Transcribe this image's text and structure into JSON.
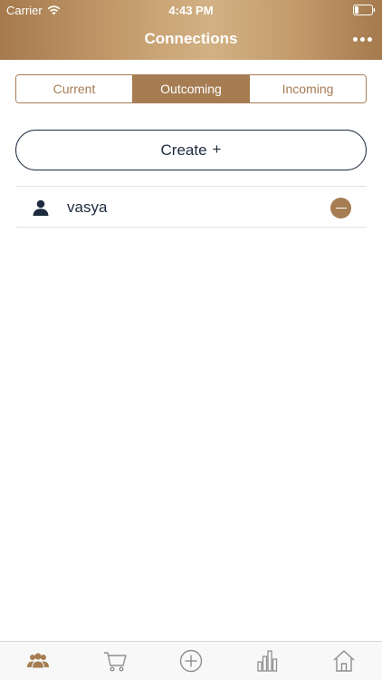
{
  "status_bar": {
    "carrier": "Carrier",
    "time": "4:43 PM"
  },
  "nav": {
    "title": "Connections",
    "more_icon": "ellipsis-icon"
  },
  "segments": [
    {
      "label": "Current",
      "active": false
    },
    {
      "label": "Outcoming",
      "active": true
    },
    {
      "label": "Incoming",
      "active": false
    }
  ],
  "create_button": {
    "label": "Create",
    "icon": "+"
  },
  "connections": [
    {
      "name": "vasya",
      "icon": "person-icon",
      "action_icon": "minus-circle-icon"
    }
  ],
  "tabbar": [
    {
      "icon": "users-icon",
      "active": true
    },
    {
      "icon": "cart-icon",
      "active": false
    },
    {
      "icon": "plus-circle-icon",
      "active": false
    },
    {
      "icon": "bar-chart-icon",
      "active": false
    },
    {
      "icon": "home-icon",
      "active": false
    }
  ],
  "colors": {
    "accent": "#a67c52",
    "text_dark": "#1e2b3f",
    "header_gradient_mid": "#d2b184"
  }
}
